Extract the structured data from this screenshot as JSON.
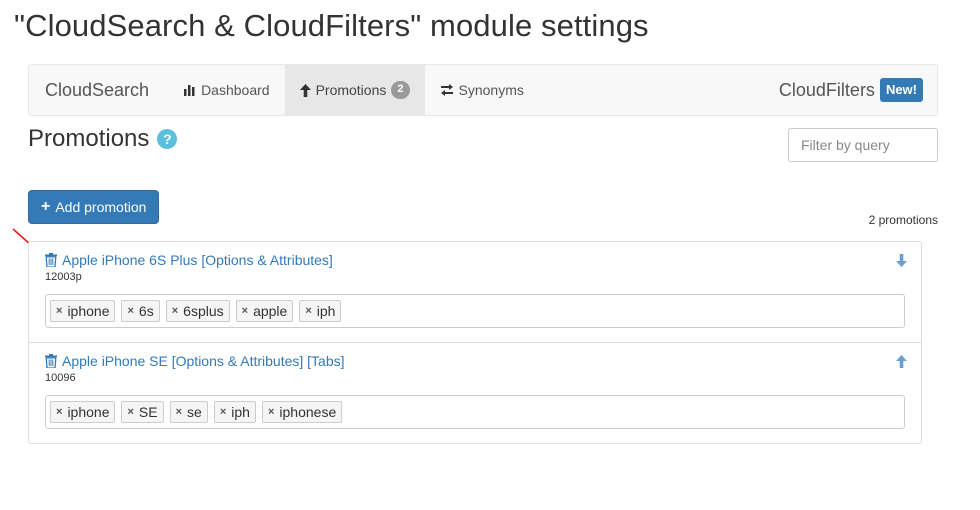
{
  "page": {
    "title": "\"CloudSearch & CloudFilters\" module settings"
  },
  "navbar": {
    "brand": "CloudSearch",
    "items": [
      {
        "label": "Dashboard",
        "icon": "bar-chart-icon",
        "active": false
      },
      {
        "label": "Promotions",
        "icon": "arrow-up-icon",
        "active": true,
        "badge": "2"
      },
      {
        "label": "Synonyms",
        "icon": "swap-icon",
        "active": false
      }
    ],
    "right_label": "CloudFilters",
    "right_badge": "New!"
  },
  "promotions": {
    "title": "Promotions",
    "help_icon": "question-circle-icon",
    "filter_placeholder": "Filter by query",
    "add_button": "Add promotion",
    "count_label": "2 promotions",
    "items": [
      {
        "title": "Apple iPhone 6S Plus [Options & Attributes]",
        "id": "12003p",
        "move_icon": "arrow-down-icon",
        "tags": [
          "iphone",
          "6s",
          "6splus",
          "apple",
          "iph"
        ]
      },
      {
        "title": "Apple iPhone SE [Options & Attributes] [Tabs]",
        "id": "10096",
        "move_icon": "arrow-up-icon",
        "tags": [
          "iphone",
          "SE",
          "se",
          "iph",
          "iphonese"
        ]
      }
    ]
  },
  "colors": {
    "accent": "#337ab7",
    "link": "#337ab7",
    "annotation_arrow": "#e02020",
    "help": "#5bc0de"
  }
}
